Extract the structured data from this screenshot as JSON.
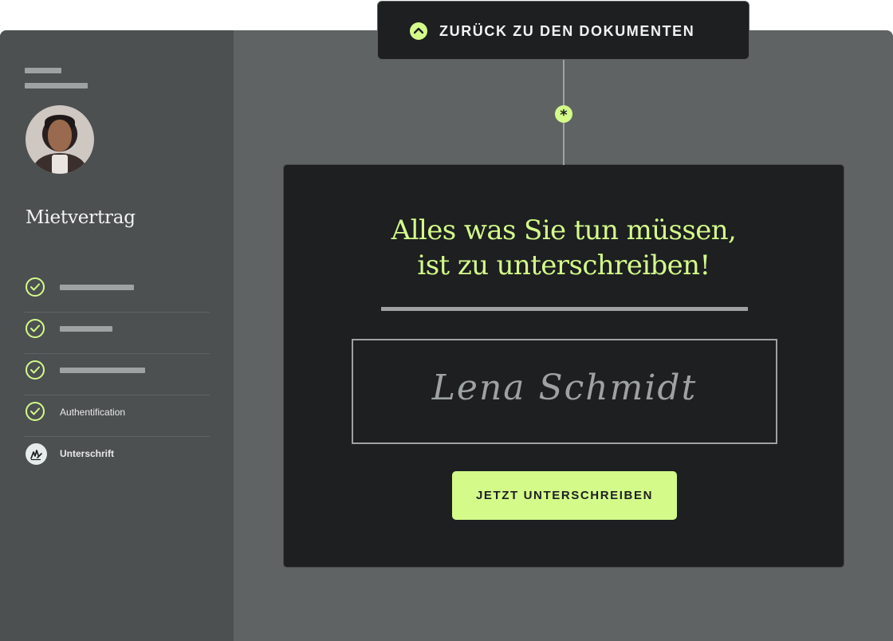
{
  "back_button": {
    "label": "ZURÜCK ZU DEN DOKUMENTEN",
    "icon": "chevron-up-icon"
  },
  "connector": {
    "marker": "*"
  },
  "sidebar": {
    "document_title": "Mietvertrag",
    "steps": [
      {
        "status": "done",
        "label": ""
      },
      {
        "status": "done",
        "label": ""
      },
      {
        "status": "done",
        "label": ""
      },
      {
        "status": "done",
        "label": "Authentification"
      },
      {
        "status": "current",
        "label": "Unterschrift"
      }
    ]
  },
  "card": {
    "headline_line1": "Alles was Sie tun müssen,",
    "headline_line2": "ist zu unterschreiben!",
    "signature_name": "Lena Schmidt",
    "sign_button": "JETZT UNTERSCHREIBEN"
  },
  "colors": {
    "accent": "#d4fb8a",
    "card_bg": "#1d1f20",
    "sidebar_bg": "#4c5051",
    "canvas_bg": "#5f6364",
    "muted": "#9ea2a3"
  }
}
